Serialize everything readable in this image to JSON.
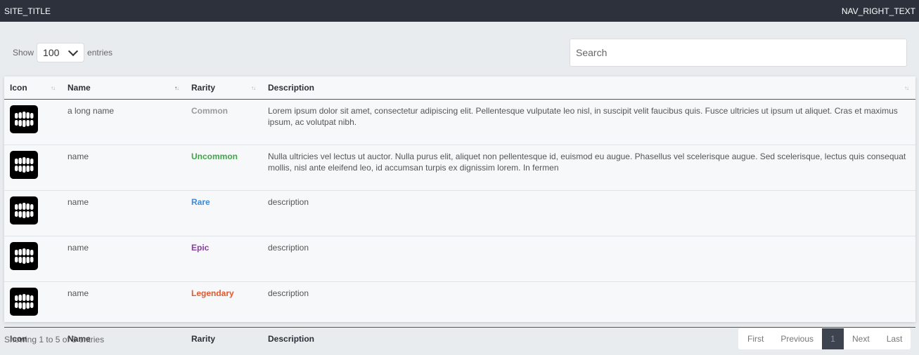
{
  "nav": {
    "title": "SITE_TITLE",
    "right": "NAV_RIGHT_TEXT"
  },
  "length_menu": {
    "prefix": "Show",
    "selected": "100",
    "suffix": "entries"
  },
  "search": {
    "placeholder": "Search",
    "value": ""
  },
  "table": {
    "columns": [
      "Icon",
      "Name",
      "Rarity",
      "Description"
    ],
    "sorted_column": "Name",
    "rows": [
      {
        "name": "a long name",
        "rarity": "Common",
        "description": "Lorem ipsum dolor sit amet, consectetur adipiscing elit. Pellentesque vulputate leo nisl, in suscipit velit faucibus quis. Fusce ultricies ut ipsum ut aliquet. Cras et maximus ipsum, ac volutpat nibh.",
        "icon": "teeth-icon"
      },
      {
        "name": "name",
        "rarity": "Uncommon",
        "description": "Nulla ultricies vel lectus ut auctor. Nulla purus elit, aliquet non pellentesque id, euismod eu augue. Phasellus vel scelerisque augue. Sed scelerisque, lectus quis consequat mollis, nisl ante eleifend leo, id accumsan turpis ex dignissim lorem. In fermen",
        "icon": "teeth-icon"
      },
      {
        "name": "name",
        "rarity": "Rare",
        "description": "description",
        "icon": "teeth-icon"
      },
      {
        "name": "name",
        "rarity": "Epic",
        "description": "description",
        "icon": "teeth-icon"
      },
      {
        "name": "name",
        "rarity": "Legendary",
        "description": "description",
        "icon": "teeth-icon"
      }
    ]
  },
  "rarity_colors": {
    "Common": "#9a9a9a",
    "Uncommon": "#3fa44a",
    "Rare": "#3c8ad8",
    "Epic": "#8a3ca0",
    "Legendary": "#e5572c"
  },
  "info": "Showing 1 to 5 of 5 entries",
  "pagination": {
    "first": "First",
    "previous": "Previous",
    "current": "1",
    "next": "Next",
    "last": "Last"
  }
}
